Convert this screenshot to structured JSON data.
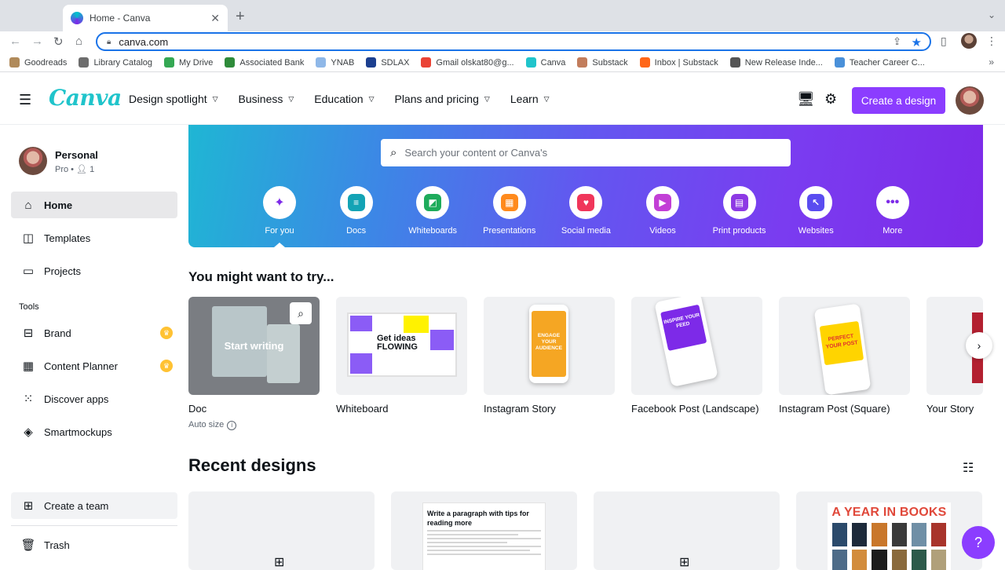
{
  "browser": {
    "tab_title": "Home - Canva",
    "tab_close": "✕",
    "new_tab": "+",
    "url": "canva.com",
    "bookmarks": [
      {
        "label": "Goodreads",
        "color": "#b08a5a"
      },
      {
        "label": "Library Catalog",
        "color": "#6d6d6d"
      },
      {
        "label": "My Drive",
        "color": "#34a853"
      },
      {
        "label": "Associated Bank",
        "color": "#2e8b3a"
      },
      {
        "label": "YNAB",
        "color": "#8fb8e8"
      },
      {
        "label": "SDLAX",
        "color": "#1c3f8f"
      },
      {
        "label": "Gmail olskat80@g...",
        "color": "#ea4335"
      },
      {
        "label": "Canva",
        "color": "#20c4cb"
      },
      {
        "label": "Substack",
        "color": "#c27d5c"
      },
      {
        "label": "Inbox | Substack",
        "color": "#ff6719"
      },
      {
        "label": "New Release Inde...",
        "color": "#555555"
      },
      {
        "label": "Teacher Career C...",
        "color": "#4a90d9"
      }
    ],
    "more_bookmarks": "»"
  },
  "header": {
    "logo": "Canva",
    "nav": [
      {
        "label": "Design spotlight"
      },
      {
        "label": "Business"
      },
      {
        "label": "Education"
      },
      {
        "label": "Plans and pricing"
      },
      {
        "label": "Learn"
      }
    ],
    "create_button": "Create a design"
  },
  "sidebar": {
    "account_name": "Personal",
    "account_sub": "Pro • ",
    "member_count": "1",
    "items": [
      {
        "label": "Home",
        "icon": "home-icon",
        "active": true
      },
      {
        "label": "Templates",
        "icon": "templates-icon"
      },
      {
        "label": "Projects",
        "icon": "folder-icon"
      }
    ],
    "tools_label": "Tools",
    "tools": [
      {
        "label": "Brand",
        "icon": "brand-icon",
        "pro": true
      },
      {
        "label": "Content Planner",
        "icon": "calendar-icon",
        "pro": true
      },
      {
        "label": "Discover apps",
        "icon": "apps-grid-icon"
      },
      {
        "label": "Smartmockups",
        "icon": "layers-icon"
      }
    ],
    "create_team": "Create a team",
    "trash": "Trash"
  },
  "hero": {
    "search_placeholder": "Search your content or Canva's",
    "categories": [
      {
        "label": "For you",
        "color": "#7d2ae8",
        "glyph": "✦"
      },
      {
        "label": "Docs",
        "color": "#13a3b5",
        "glyph": "≡"
      },
      {
        "label": "Whiteboards",
        "color": "#1eab5b",
        "glyph": "◩"
      },
      {
        "label": "Presentations",
        "color": "#ff8a1c",
        "glyph": "▦"
      },
      {
        "label": "Social media",
        "color": "#f0365b",
        "glyph": "♥"
      },
      {
        "label": "Videos",
        "color": "#c23fd6",
        "glyph": "▶"
      },
      {
        "label": "Print products",
        "color": "#8d39e4",
        "glyph": "▤"
      },
      {
        "label": "Websites",
        "color": "#5a4cf0",
        "glyph": "↖"
      },
      {
        "label": "More",
        "color": "#7d2ae8",
        "glyph": "•••"
      }
    ]
  },
  "suggestions": {
    "title": "You might want to try...",
    "items": [
      {
        "title": "Doc",
        "subtitle": "Auto size",
        "overlay": "Start writing"
      },
      {
        "title": "Whiteboard",
        "thumb_text": "Get ideas FLOWING"
      },
      {
        "title": "Instagram Story",
        "thumb_text": "ENGAGE YOUR AUDIENCE"
      },
      {
        "title": "Facebook Post (Landscape)",
        "thumb_text": "INSPIRE YOUR FEED"
      },
      {
        "title": "Instagram Post (Square)",
        "thumb_text": "PERFECT YOUR POST"
      },
      {
        "title": "Your Story"
      }
    ]
  },
  "recent": {
    "title": "Recent designs",
    "doc_heading": "Write a paragraph with tips for reading more",
    "year_in_books": "A YEAR IN BOOKS"
  },
  "help_button": "?"
}
